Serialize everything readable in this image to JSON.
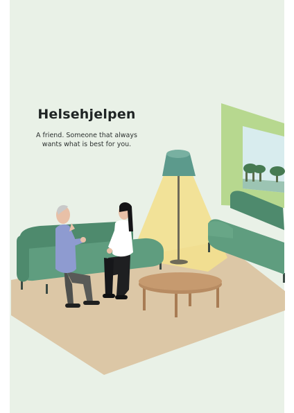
{
  "poster": {
    "title": "Helsehjelpen",
    "tagline_line1": "A friend. Someone that always",
    "tagline_line2": "wants what is best for you."
  },
  "illustration": {
    "subject": "person-on-sofa-talking-with-older-man-under-floor-lamp",
    "icons": [
      "sofa",
      "floor-lamp",
      "coffee-table",
      "window",
      "rug",
      "person",
      "person"
    ]
  },
  "colors": {
    "letterbox": "#ffffff",
    "wall": "#e9f1e7",
    "floor_rug": "#dcc7a6",
    "sofa": "#5f9d7f",
    "sofa_dark": "#4e8a6d",
    "lamp_shade": "#5c9a8c",
    "light_cone": "#f3e08f",
    "window_frame": "#b7d88f",
    "table": "#c69a6f",
    "text": "#1f2424"
  }
}
